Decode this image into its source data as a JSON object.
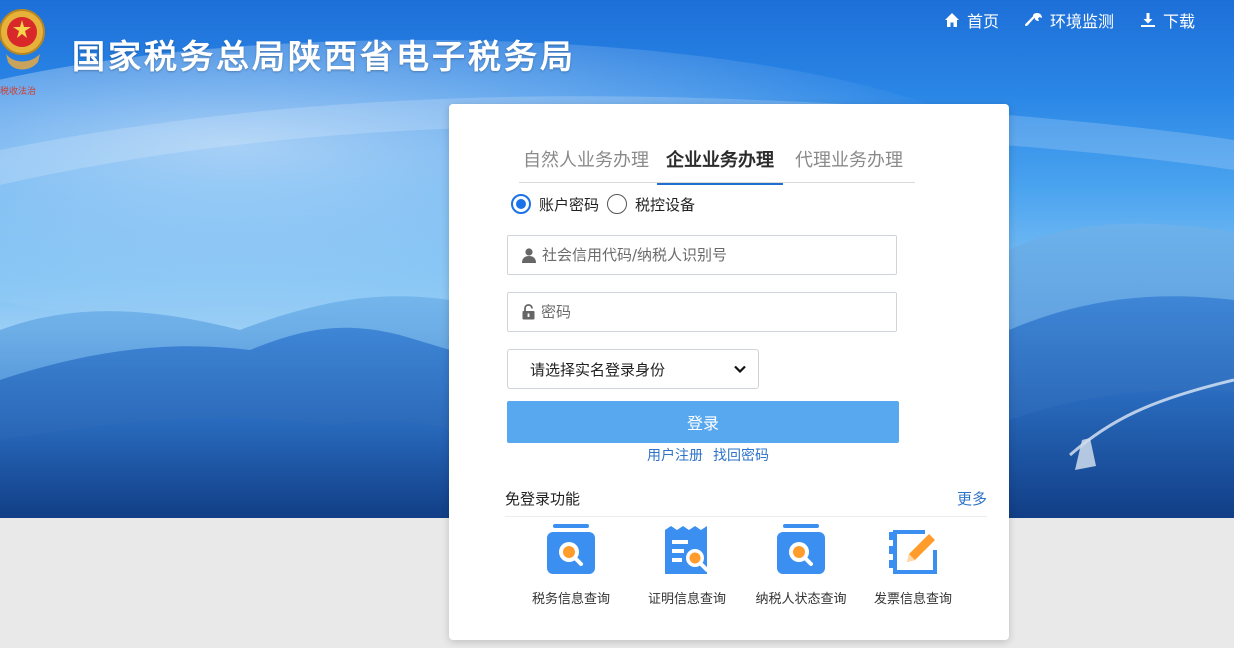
{
  "header": {
    "site_title": "国家税务总局陕西省电子税务局",
    "emblem_text": "税收法治",
    "nav": [
      {
        "label": "首页",
        "icon": "home-icon"
      },
      {
        "label": "环境监测",
        "icon": "wrench-icon"
      },
      {
        "label": "下载",
        "icon": "download-icon"
      }
    ]
  },
  "login": {
    "tabs": [
      "自然人业务办理",
      "企业业务办理",
      "代理业务办理"
    ],
    "active_tab": "企业业务办理",
    "radios": [
      {
        "label": "账户密码",
        "checked": true
      },
      {
        "label": "税控设备",
        "checked": false
      }
    ],
    "username_placeholder": "社会信用代码/纳税人识别号",
    "password_placeholder": "密码",
    "identity_select": "请选择实名登录身份",
    "submit_label": "登录",
    "register_link": "用户注册",
    "forgot_link": "找回密码"
  },
  "quick_access": {
    "title": "免登录功能",
    "more_label": "更多",
    "items": [
      {
        "label": "税务信息查询",
        "icon": "tax-search-icon"
      },
      {
        "label": "证明信息查询",
        "icon": "certificate-search-icon"
      },
      {
        "label": "纳税人状态查询",
        "icon": "taxpayer-search-icon"
      },
      {
        "label": "发票信息查询",
        "icon": "invoice-edit-icon"
      }
    ]
  },
  "colors": {
    "accent": "#1e6fcf",
    "login_button": "#58a8f0",
    "link": "#2d73c8",
    "icon_blue": "#3b8ff0",
    "icon_orange": "#ff9c2b"
  }
}
